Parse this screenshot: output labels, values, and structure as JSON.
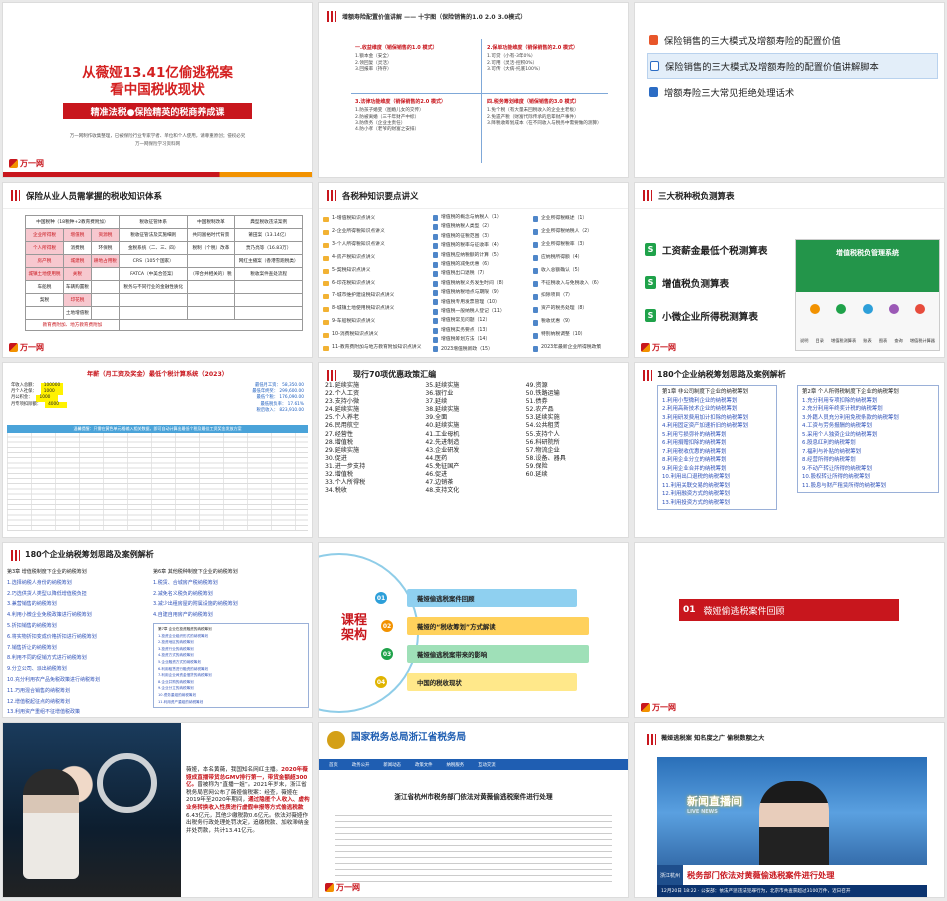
{
  "s1": {
    "title_line1": "从薇娅13.41亿偷逃税案",
    "title_line2": "看中国税收现状",
    "band": "精准法税●保险精英的税商养成课",
    "small1": "万一网制作收集整理，已被保险行业专家学者、单位和个人使用，请尊重原创；侵权必究",
    "small2": "万一网保险学习资料网",
    "logo": "万一网"
  },
  "s2": {
    "title": "增额寿险配置价值讲解 —— 十字图（保险销售的1.0 2.0 3.0模式）",
    "q1": {
      "title": "一.收益维度（销保销售的1.0 模式）",
      "lines": [
        "1.额本金（安全）",
        "2.领回复（灵活）",
        "3.回报率（持存）"
      ]
    },
    "q2": {
      "title": "2.保单功能维度（销保销售的2.0 模式）",
      "lines": [
        "1.可贷（小有-3年0%）",
        "2.可用（灵活-控积0%）",
        "3.可传（大病-托底100%）"
      ]
    },
    "q3": {
      "title": "3.法律功能维度（销保销售的2.0 模式）",
      "lines": [
        "1.防孩子婚变（图婚儿女的交传）",
        "2.防被离婚（三千年财产中标）",
        "3.防债务（企业主责任）",
        "4.防小孝（老爷的财富之安排）"
      ]
    },
    "q4": {
      "title": "四.税务筹划维度（销保销售的3.0 模式）",
      "lines": [
        "1.免个税（有大量未回税收入的企业主老板）",
        "2.免遗产税（财富代际传承的后辈财产事件）",
        "3.降税收筹划成本（在不同收入与税务中需要做的测算）"
      ]
    }
  },
  "s3": {
    "items": [
      {
        "label": "保险销售的三大模式及增额寿险的配置价值"
      },
      {
        "label": "保险销售的三大模式及增额寿险的配置价值讲解脚本"
      },
      {
        "label": "增额寿险三大常见拒绝处理话术"
      }
    ]
  },
  "s4": {
    "title": "保险从业人员需掌握的税收知识体系",
    "headers": [
      "中国税种（18税种+2教育费附加）",
      "税收征管体系",
      "中国税制改革",
      "典型税收违法案例"
    ],
    "rows": [
      [
        "企业所得税",
        "增值税",
        "资源税",
        "税收征管法及实施细则",
        "共同富裕时代背景",
        "莆田案（13.14亿）"
      ],
      [
        "个人所得税",
        "消费税",
        "环保税",
        "金税系统（二、三、四）",
        "税制（个税）改革",
        "贾乃亮等（16.83万）"
      ],
      [
        "房产税",
        "城建税",
        "耕地占用税",
        "CRS（105个国家）",
        "",
        "网红主播案（香港雪跑税类）"
      ],
      [
        "城镇土地使用税",
        "关税",
        "",
        "FATCA（中美合签案）",
        "（带合并相关的）税",
        "税收案件查处流程"
      ],
      [
        "车船税",
        "车辆购置税",
        "",
        "税务与不同行业的金融性质化",
        "",
        ""
      ],
      [
        "契税",
        "印花税",
        "",
        "",
        "",
        ""
      ],
      [
        "",
        "土地增值税",
        "",
        "",
        "",
        ""
      ]
    ],
    "note": "教育费附加、地方教育费附加"
  },
  "s5": {
    "title": "各税种知识要点讲义",
    "col1": [
      "1-增值税知识点讲义",
      "2-企业所得税知识点讲义",
      "3-个人所得税知识点讲义",
      "4-房产税知识点讲义",
      "5-契税知识点讲义",
      "6-印花税知识点讲义",
      "7-城市维护建设税知识点讲义",
      "8-城镇土地使用税知识点讲义",
      "9-车船税知识点讲义",
      "10-消费税知识点讲义",
      "11-教育费附加与地方教育附加知识点讲义"
    ],
    "col2": [
      "增值税的概念与纳税人（1）",
      "增值税纳税人类型（2）",
      "增值税的征税范围（3）",
      "增值税的税率与征收率（4）",
      "增值税应纳税额的计算（5）",
      "增值税的减免优惠（6）",
      "增值税出口退税（7）",
      "增值税纳税义务发生时间（8）",
      "增值税纳税地点与期限（9）",
      "增值税专用发票管理（10）",
      "增值税一般纳税人登记（11）",
      "增值税常见问题（12）",
      "增值税实务要点（13）",
      "增值税筹划方法（14）",
      "2023增值税新政（15）"
    ],
    "col3": [
      "企业所得税概述（1）",
      "企业所得税纳税人（2）",
      "企业所得税税率（3）",
      "应纳税所得额（4）",
      "收入总额确认（5）",
      "不征税收入与免税收入（6）",
      "扣除项目（7）",
      "资产的税务处理（8）",
      "税收优惠（9）",
      "特别纳税调整（10）",
      "2023年最新企业所得税政策"
    ]
  },
  "s6": {
    "title": "三大税种税负测算表",
    "items": [
      {
        "label": "工资薪金最低个税测算表"
      },
      {
        "label": "增值税负测算表"
      },
      {
        "label": "小微企业所得税测算表"
      }
    ],
    "app_title": "增值税税负管理系统",
    "app_menu": [
      "说明",
      "目录",
      "增值税测算表",
      "账表",
      "图表",
      "查询",
      "增值税计算器"
    ]
  },
  "s7": {
    "title": "年薪（月工资及奖金）最低个税计算系统（2023）",
    "inputs": [
      {
        "label": "年收入总额：",
        "value": "100000"
      },
      {
        "label": "月个人社保：",
        "value": "1000"
      },
      {
        "label": "月公积金：",
        "value": "1000"
      },
      {
        "label": "月专项扣除额：",
        "value": "4000"
      }
    ],
    "results": [
      {
        "label": "最低月工资：",
        "value": "58,350.00"
      },
      {
        "label": "最低年终奖：",
        "value": "299,600.00"
      },
      {
        "label": "最低个税：",
        "value": "176,090.00"
      },
      {
        "label": "最低税负率：",
        "value": "17.61%"
      },
      {
        "label": "税后收入：",
        "value": "823,910.00"
      }
    ],
    "band": "温馨提醒：只需在黄色单元格输入相关数据，即可自动计算出最低个税及最佳工资奖金发放方案"
  },
  "s8": {
    "title": "现行70项优惠政策汇编",
    "items": [
      "21.延续实施",
      "22.个人工资",
      "23.支持小微",
      "24.延续实施",
      "25.个人养老",
      "26.民用航空",
      "27.经营性",
      "28.增值税",
      "29.延续实施",
      "30.促进",
      "31.进一步支持",
      "32.增值税",
      "33.个人所得税",
      "34.税收",
      "35.延续实施",
      "36.银行业",
      "37.延续",
      "38.延续实施",
      "39.全面",
      "40.延续实施",
      "41.工业母机",
      "42.先进制造",
      "43.企业研发",
      "44.医药",
      "45.免征国产",
      "46.促进",
      "47.边销茶",
      "48.支持文化",
      "49.资源",
      "50.铁路运输",
      "51.债券",
      "52.农产品",
      "53.延续实施",
      "54.公共租赁",
      "55.支持个人",
      "56.科研院所",
      "57.物流企业",
      "58.设备、器具",
      "59.保险",
      "60.延续"
    ]
  },
  "s9": {
    "title": "180个企业纳税筹划思路及案例解析",
    "left_head": "第1章 非公司制度下企业的纳税筹划",
    "left": [
      "1.利用小型微利企业的纳税筹划",
      "2.利用高新技术企业的纳税筹划",
      "3.利用研发费用加计扣除的纳税筹划",
      "4.利用固定资产加速折旧的纳税筹划",
      "5.利用亏损弥补的纳税筹划",
      "6.利用捐赠扣除的纳税筹划",
      "7.利用税收优惠的纳税筹划",
      "8.利用企业分立的纳税筹划",
      "9.利用企业合并的纳税筹划",
      "10.利用出口退税的纳税筹划",
      "11.利用关联交易的纳税筹划",
      "12.利用融资方式的纳税筹划",
      "13.利用投资方式的纳税筹划"
    ],
    "right_head": "第2章 个人所得税制度下企业的纳税筹划",
    "right": [
      "1.充分利用专项扣除的纳税筹划",
      "2.充分利用年终奖计税的纳税筹划",
      "3.外籍人员充分利用免税条款的纳税筹划",
      "4.工资与劳务报酬的纳税筹划",
      "5.采用个人独资企业的纳税筹划",
      "6.股息红利的纳税筹划",
      "7.福利与补贴的纳税筹划",
      "8.经营所得的纳税筹划",
      "9.不动产转让所得的纳税筹划",
      "10.股权转让所得的纳税筹划",
      "11.股息与财产租赁所得的纳税筹划"
    ]
  },
  "s10": {
    "title": "180个企业纳税筹划思路及案例解析",
    "left_head": "第3章 增值税制度下企业的纳税筹划",
    "left": [
      "1.选择纳税人身份的纳税筹划",
      "2.巧选供货人类型以降低增值税负担",
      "3.兼营销售的纳税筹划",
      "4.利用小微企业免税政策进行纳税筹划",
      "5.折扣销售的纳税筹划",
      "6.将实物折扣变成价格折扣进行纳税筹划",
      "7.销售折让的纳税筹划",
      "8.利用不同的促销方式进行纳税筹划",
      "9.分立公司、派出纳税筹划",
      "10.充分利用农产品免税政策进行纳税筹划",
      "11.巧用混合销售的纳税筹划",
      "12.增值税起征点的纳税筹划",
      "13.利用资产重组不征增值税政策"
    ],
    "right_head": "第6章 其他税种制度下企业的纳税筹划",
    "right": [
      "1.税赁、合城房产税纳税筹划",
      "2.减免名义税负的纳税筹划",
      "3.减少出租房屋的附属设施的纳税筹划",
      "4.自建自用房产的纳税筹划"
    ],
    "right_head2": "第7章 企业在投资融资的纳税筹划",
    "right2": [
      "1.投资企业组织形式的纳税筹划",
      "2.投资地区的纳税筹划",
      "3.投资行业的纳税筹划",
      "4.投资方式的纳税筹划",
      "5.企业融资方式的纳税筹划",
      "6.利用租赁进行融资的纳税筹划",
      "7.利用企业间资金借贷的纳税筹划",
      "8.企业并购的纳税筹划",
      "9.企业分立的纳税筹划",
      "10.债务重组的纳税筹划",
      "11.利用资产重组的纳税筹划"
    ]
  },
  "s11": {
    "label": "课程架构",
    "items": [
      {
        "num": "01",
        "label": "薇娅偷逃税案件回顾",
        "color": "#8fd0f0",
        "dot": "#2d9fd9"
      },
      {
        "num": "02",
        "label": "薇娅的“税收筹划”方式解读",
        "color": "#ffd15c",
        "dot": "#f29200"
      },
      {
        "num": "03",
        "label": "薇娅偷逃税案带来的影响",
        "color": "#9fe0b8",
        "dot": "#1fa24a"
      },
      {
        "num": "04",
        "label": "中国的税收现状",
        "color": "#ffe88a",
        "dot": "#e0b400"
      }
    ]
  },
  "s12": {
    "num": "01",
    "label": "薇娅偷逃税案件回顾"
  },
  "s13": {
    "text_plain1": "薇娅，本名黄薇，我国知名网红主播。",
    "text_hl1": "2020年薇娅成直播带货总GMV排行第一，带货金额超300亿。",
    "text_plain2": "曾被称为“直播一姐”。2021年岁末，浙江省税务局官网公布了薇娅偷税案：经查，薇娅在2019年至2020年期间，",
    "text_hl2": "通过隐匿个人收入、虚构业务转换收入性质进行虚假申报等方式偷逃税款",
    "text_plain3": "6.43亿元，其他少缴税款0.6亿元。依法对薇娅作出税务行政处理处罚决定，追缴税款、加收滞纳金并处罚款，共计13.41亿元。"
  },
  "s14": {
    "site_title": "国家税务总局浙江省税务局",
    "nav": [
      "首页",
      "政务公开",
      "新闻动态",
      "政策文件",
      "纳税服务",
      "互动交流"
    ],
    "article_title": "浙江省杭州市税务部门依法对黄薇偷逃税案件进行处理"
  },
  "s15": {
    "title": "薇娅逃税案  知名度之广  偷税数额之大",
    "live": "新闻直播间",
    "live_en": "LIVE NEWS",
    "tag": "浙江杭州",
    "headline": "税务部门依法对黄薇偷逃税案件进行处理",
    "ticker": "12月20日 18:22 · 公安部：依法严惩违法犯罪行为，北京市共查获超过3100万件，近日召开"
  },
  "logo_text": "万一网"
}
